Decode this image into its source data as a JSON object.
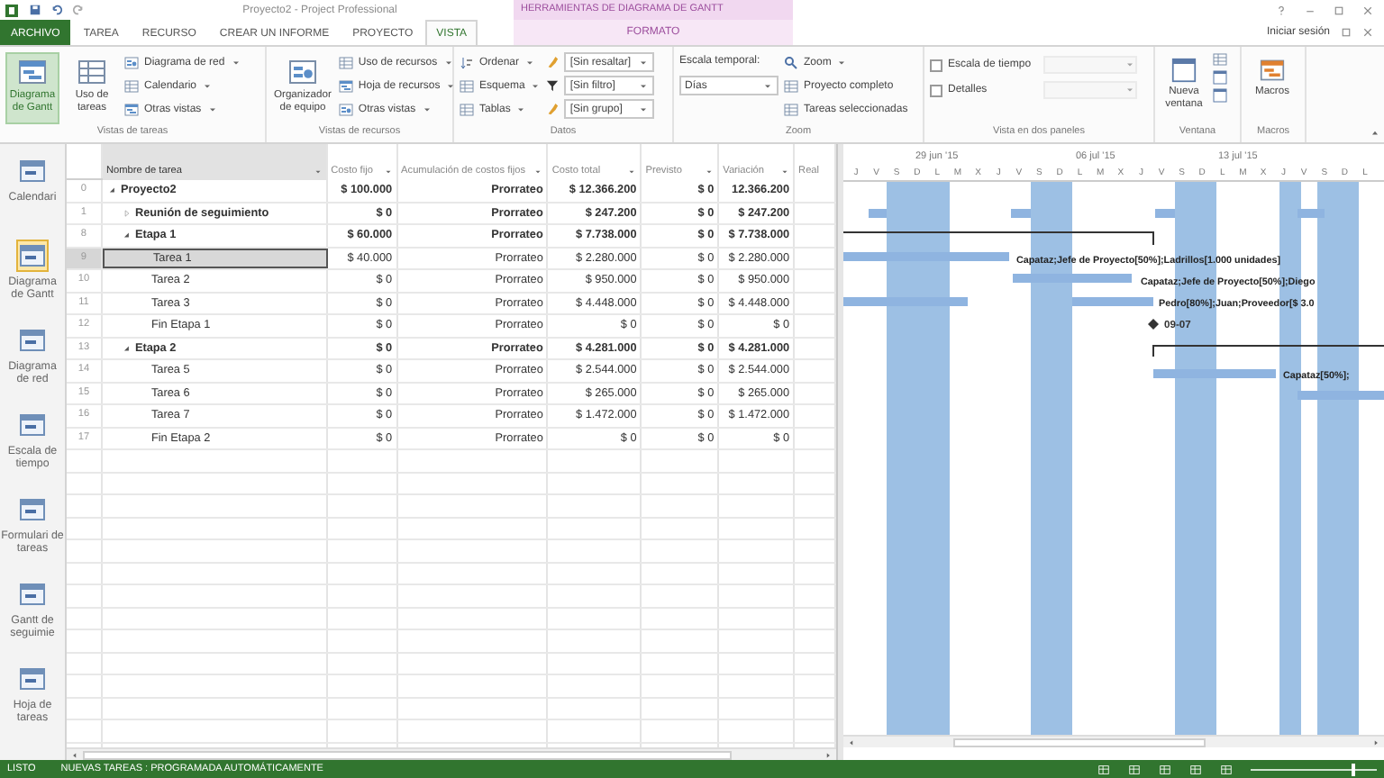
{
  "title_bar": {
    "title": "Proyecto2 - Project Professional",
    "context_label": "HERRAMIENTAS DE DIAGRAMA DE GANTT"
  },
  "tabs": [
    {
      "label": "ARCHIVO",
      "selected": false,
      "kind": "file"
    },
    {
      "label": "TAREA",
      "selected": false,
      "kind": "normal"
    },
    {
      "label": "RECURSO",
      "selected": false,
      "kind": "normal"
    },
    {
      "label": "CREAR UN INFORME",
      "selected": false,
      "kind": "normal"
    },
    {
      "label": "PROYECTO",
      "selected": false,
      "kind": "normal"
    },
    {
      "label": "VISTA",
      "selected": true,
      "kind": "normal"
    },
    {
      "label": "FORMATO",
      "selected": false,
      "kind": "context"
    }
  ],
  "sign_in": "Iniciar sesión",
  "ribbon": {
    "task_views": {
      "label": "Vistas de tareas",
      "large": [
        {
          "label": "Diagrama de Gantt",
          "selected": true
        },
        {
          "label": "Uso de tareas",
          "selected": false
        }
      ],
      "small": [
        "Diagrama de red",
        "Calendario",
        "Otras vistas"
      ]
    },
    "resource_views": {
      "label": "Vistas de recursos",
      "large": [
        {
          "label": "Organizador de equipo",
          "selected": false
        }
      ],
      "small": [
        "Uso de recursos",
        "Hoja de recursos",
        "Otras vistas"
      ]
    },
    "data": {
      "label": "Datos",
      "commands": [
        "Ordenar",
        "Esquema",
        "Tablas"
      ],
      "dropdowns": [
        "[Sin resaltar]",
        "[Sin filtro]",
        "[Sin grupo]"
      ]
    },
    "zoom": {
      "label": "Zoom",
      "timescale_label": "Escala temporal:",
      "timescale_value": "Días",
      "commands": [
        "Zoom",
        "Proyecto completo",
        "Tareas seleccionadas"
      ]
    },
    "split_view": {
      "label": "Vista en dos paneles",
      "options": [
        {
          "label": "Escala de tiempo",
          "checked": false
        },
        {
          "label": "Detalles",
          "checked": false
        }
      ]
    },
    "window": {
      "label": "Ventana",
      "command": "Nueva ventana"
    },
    "macros": {
      "label": "Macros",
      "command": "Macros"
    }
  },
  "view_bar": [
    {
      "label": "Calendari",
      "selected": false
    },
    {
      "label": "Diagrama de Gantt",
      "selected": true
    },
    {
      "label": "Diagrama de red",
      "selected": false
    },
    {
      "label": "Escala de tiempo",
      "selected": false
    },
    {
      "label": "Formulari de tareas",
      "selected": false
    },
    {
      "label": "Gantt de seguimie",
      "selected": false
    },
    {
      "label": "Hoja de tareas",
      "selected": false
    }
  ],
  "table": {
    "columns": [
      "Nombre de tarea",
      "Costo fijo",
      "Acumulación de costos fijos",
      "Costo total",
      "Previsto",
      "Variación",
      "Real"
    ],
    "rows": [
      {
        "id": "0",
        "name": "Proyecto2",
        "expanded": true,
        "selected": false,
        "fixed_cost": "$ 100.000",
        "accrual": "Prorrateo",
        "total_cost": "$ 12.366.200",
        "baseline": "$ 0",
        "variance": "12.366.200",
        "children": [
          {
            "id": "1",
            "name": "Reunión de seguimiento",
            "expanded": false,
            "selected": false,
            "fixed_cost": "$ 0",
            "accrual": "Prorrateo",
            "total_cost": "$ 247.200",
            "baseline": "$ 0",
            "variance": "$ 247.200"
          },
          {
            "id": "8",
            "name": "Etapa 1",
            "expanded": true,
            "selected": false,
            "fixed_cost": "$ 60.000",
            "accrual": "Prorrateo",
            "total_cost": "$ 7.738.000",
            "baseline": "$ 0",
            "variance": "$ 7.738.000",
            "children": [
              {
                "id": "9",
                "name": "Tarea 1",
                "selected": true,
                "fixed_cost": "$ 40.000",
                "accrual": "Prorrateo",
                "total_cost": "$ 2.280.000",
                "baseline": "$ 0",
                "variance": "$ 2.280.000"
              },
              {
                "id": "10",
                "name": "Tarea 2",
                "selected": false,
                "fixed_cost": "$ 0",
                "accrual": "Prorrateo",
                "total_cost": "$ 950.000",
                "baseline": "$ 0",
                "variance": "$ 950.000"
              },
              {
                "id": "11",
                "name": "Tarea 3",
                "selected": false,
                "fixed_cost": "$ 0",
                "accrual": "Prorrateo",
                "total_cost": "$ 4.448.000",
                "baseline": "$ 0",
                "variance": "$ 4.448.000"
              },
              {
                "id": "12",
                "name": "Fin Etapa 1",
                "selected": false,
                "fixed_cost": "$ 0",
                "accrual": "Prorrateo",
                "total_cost": "$ 0",
                "baseline": "$ 0",
                "variance": "$ 0"
              }
            ]
          },
          {
            "id": "13",
            "name": "Etapa 2",
            "expanded": true,
            "selected": false,
            "fixed_cost": "$ 0",
            "accrual": "Prorrateo",
            "total_cost": "$ 4.281.000",
            "baseline": "$ 0",
            "variance": "$ 4.281.000",
            "children": [
              {
                "id": "14",
                "name": "Tarea 5",
                "selected": false,
                "fixed_cost": "$ 0",
                "accrual": "Prorrateo",
                "total_cost": "$ 2.544.000",
                "baseline": "$ 0",
                "variance": "$ 2.544.000"
              },
              {
                "id": "15",
                "name": "Tarea 6",
                "selected": false,
                "fixed_cost": "$ 0",
                "accrual": "Prorrateo",
                "total_cost": "$ 265.000",
                "baseline": "$ 0",
                "variance": "$ 265.000"
              },
              {
                "id": "16",
                "name": "Tarea 7",
                "selected": false,
                "fixed_cost": "$ 0",
                "accrual": "Prorrateo",
                "total_cost": "$ 1.472.000",
                "baseline": "$ 0",
                "variance": "$ 1.472.000"
              },
              {
                "id": "17",
                "name": "Fin Etapa 2",
                "selected": false,
                "fixed_cost": "$ 0",
                "accrual": "Prorrateo",
                "total_cost": "$ 0",
                "baseline": "$ 0",
                "variance": "$ 0"
              }
            ]
          }
        ]
      }
    ]
  },
  "gantt": {
    "weeks": [
      "29 jun '15",
      "06 jul '15",
      "13 jul '15"
    ],
    "days": [
      "J",
      "V",
      "S",
      "D",
      "L",
      "M",
      "X",
      "J",
      "V",
      "S",
      "D",
      "L",
      "M",
      "X",
      "J",
      "V",
      "S",
      "D",
      "L",
      "M",
      "X",
      "J",
      "V",
      "S",
      "D",
      "L"
    ],
    "bar_labels": [
      "Capataz;Jefe de Proyecto[50%];Ladrillos[1.000 unidades]",
      "Capataz;Jefe de Proyecto[50%];Diego",
      "Pedro[80%];Juan;Proveedor[$ 3.0",
      "Capataz[50%];"
    ],
    "milestone_date": "09-07"
  },
  "status_bar": {
    "state": "LISTO",
    "new_tasks": "NUEVAS TAREAS : PROGRAMADA AUTOMÁTICAMENTE",
    "zoom": {
      "level": 0.8
    }
  }
}
